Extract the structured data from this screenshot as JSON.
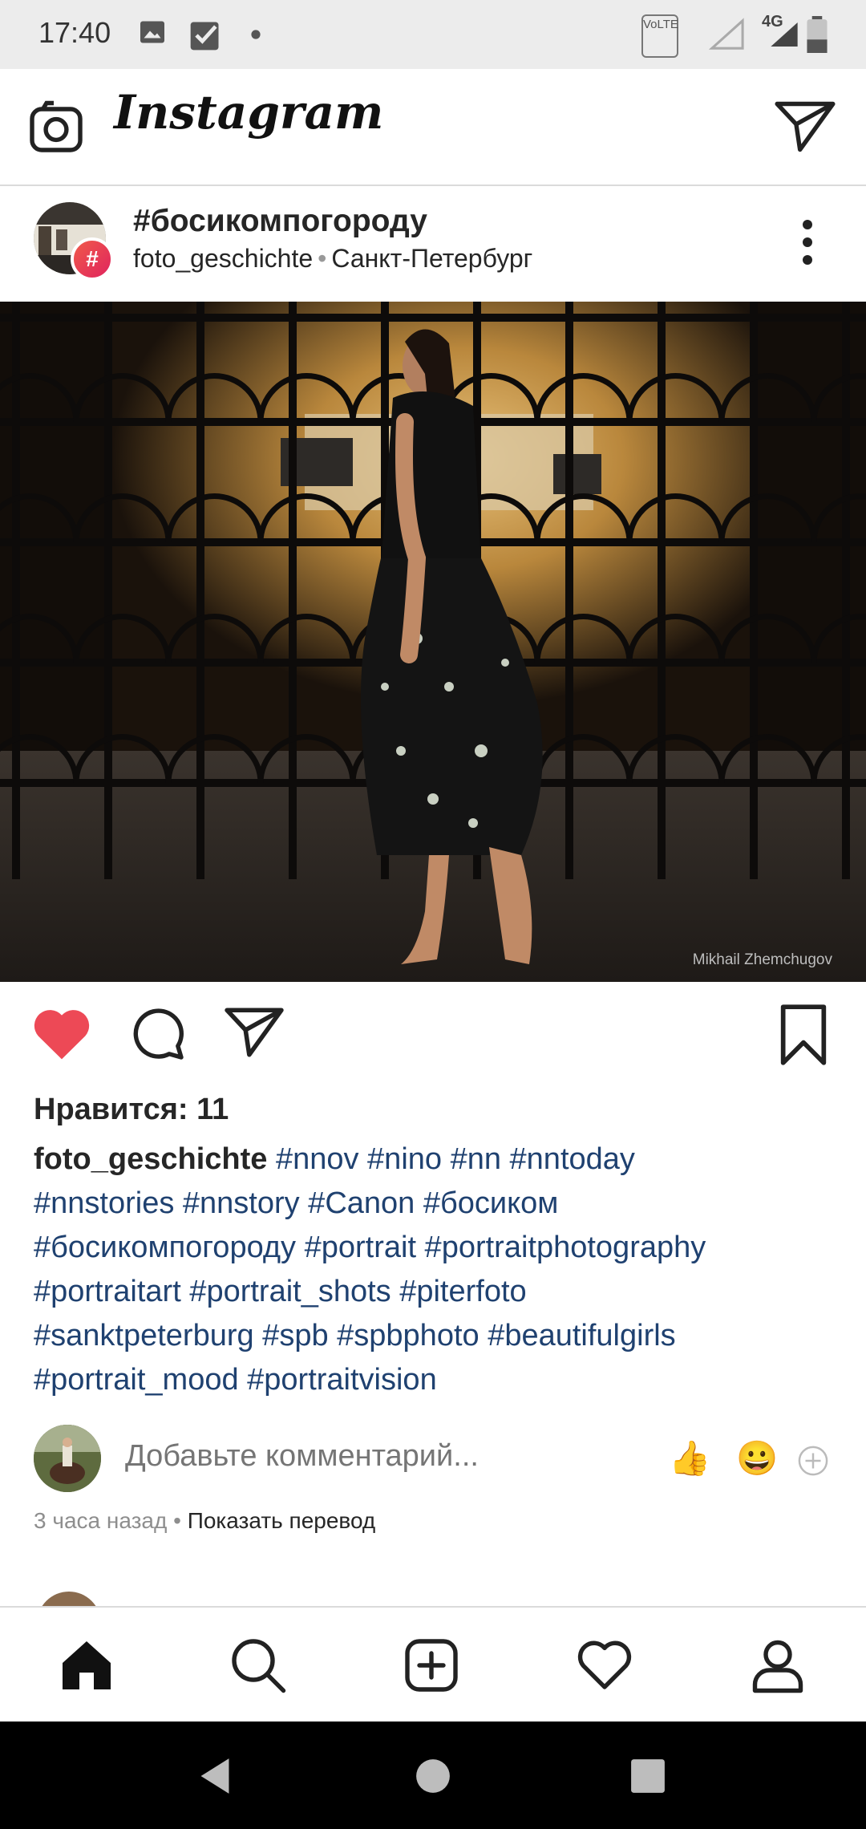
{
  "status_bar": {
    "time": "17:40",
    "icons": [
      "image-icon",
      "checkbox-icon",
      "dot-icon",
      "volte-icon",
      "signal-icon",
      "4g-icon",
      "battery-icon"
    ],
    "network_label": "4G",
    "volte_label": "VoLTE"
  },
  "app_bar": {
    "logo_text": "Instagram",
    "left_icon": "camera-icon",
    "right_icon": "direct-message-icon"
  },
  "post": {
    "title": "#босикомпогороду",
    "username": "foto_geschichte",
    "location": "Санкт-Петербург",
    "badge_text": "#",
    "photo_credit": "Mikhail Zhemchugov",
    "likes_text": "Нравится: 11",
    "caption_user": "foto_geschichte",
    "caption_lines": [
      "#nnov #nino #nn #nntoday",
      "#nnstories #nnstory #Canon #босиком",
      "#босикомпогороду #portrait #portraitphotography",
      "#portraitart #portrait_shots #piterfoto",
      "#sanktpeterburg #spb #spbphoto #beautifulgirls",
      "#portrait_mood #portraitvision"
    ],
    "comment_placeholder": "Добавьте комментарий...",
    "quick_emojis": [
      "👍",
      "😀"
    ],
    "time_ago": "3 часа назад",
    "translate_label": "Показать перевод"
  },
  "colors": {
    "like_red": "#ed4956",
    "hashtag_blue": "#1f4170",
    "muted_gray": "#8e8e8e"
  },
  "bottom_nav": [
    "home-icon",
    "search-icon",
    "new-post-icon",
    "activity-heart-icon",
    "profile-icon"
  ],
  "system_nav": [
    "back-icon",
    "home-circle-icon",
    "recents-icon"
  ]
}
